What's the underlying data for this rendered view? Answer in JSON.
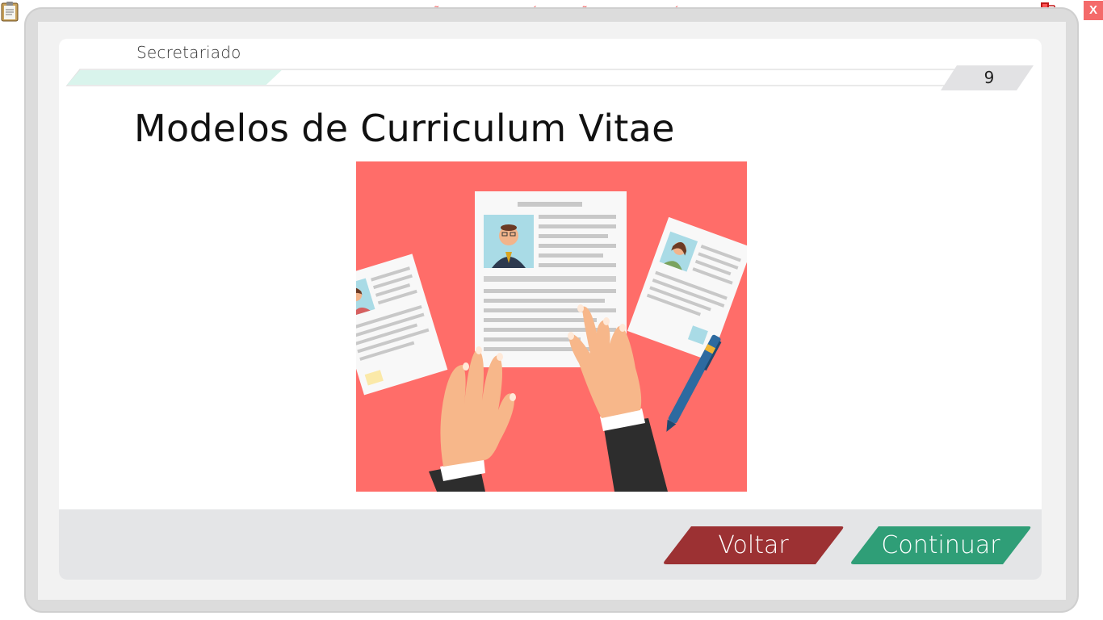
{
  "window": {
    "banner": "VERSÃO PARA FUNCIONÁRIOS - NÃO COMERCIALIZÁVEL",
    "close_label": "X",
    "icons": [
      "clipboard-icon",
      "network-icon"
    ]
  },
  "header": {
    "section_title": "Secretariado",
    "page_number": "9",
    "progress": 0.23
  },
  "content": {
    "title": "Modelos de Curriculum Vitae"
  },
  "footer": {
    "back_label": "Voltar",
    "continue_label": "Continuar"
  },
  "colors": {
    "back_button": "#9c3133",
    "continue_button": "#2f9e77",
    "progress_fill": "#d9f4ec",
    "illustration_bg": "#ff6d69"
  }
}
